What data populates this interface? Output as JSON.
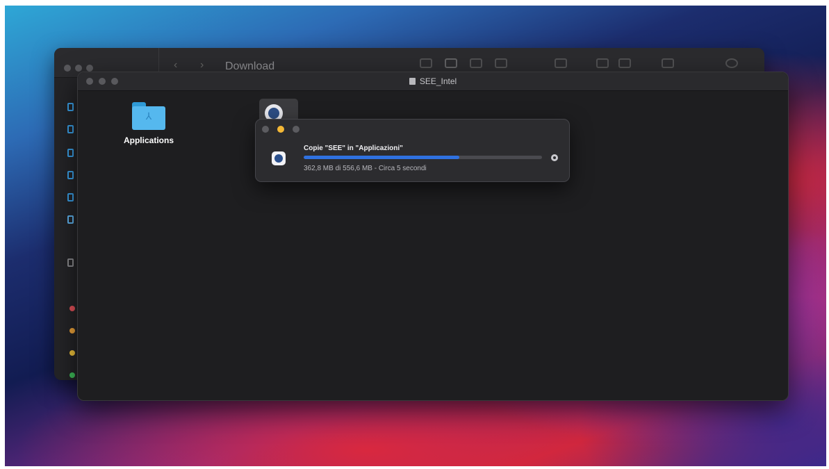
{
  "back_window": {
    "title": "Download"
  },
  "front_window": {
    "title": "SEE_Intel",
    "items": [
      {
        "label": "Applications",
        "icon": "folder-icon"
      },
      {
        "label": "",
        "icon": "see-app-icon"
      }
    ]
  },
  "copy_dialog": {
    "title": "Copie \"SEE\" in \"Applicazioni\"",
    "status": "362,8 MB di 556,6 MB - Circa 5 secondi",
    "progress_fraction": 0.652,
    "progress_color": "#2f71e0",
    "icon": "see-app-icon"
  },
  "sidebar_tag_colors": [
    "#e6525a",
    "#f0a43a",
    "#f1c43b",
    "#3fbf5a"
  ],
  "accent": "#3aa0e8"
}
